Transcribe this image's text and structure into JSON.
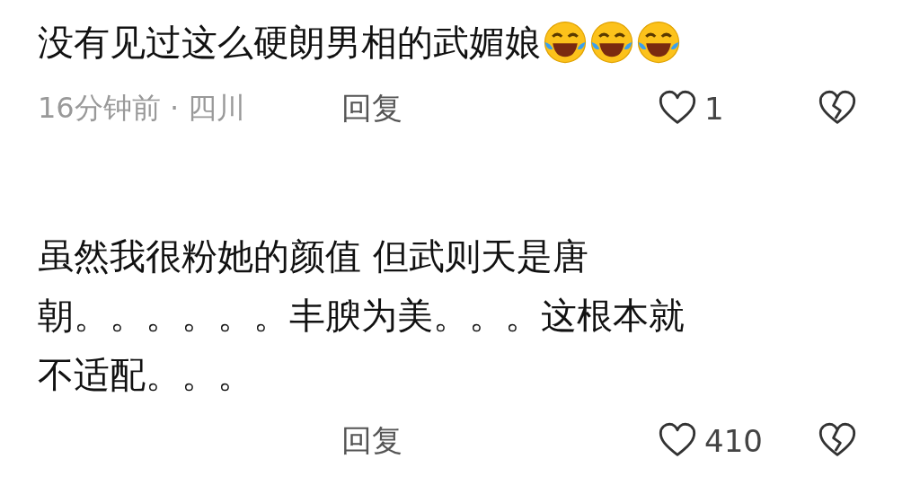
{
  "comments": [
    {
      "text_lines": [
        "没有见过这么硬朗男相的武媚娘"
      ],
      "emojis": [
        {
          "kind": "laugh-cry"
        },
        {
          "kind": "laugh-cry"
        },
        {
          "kind": "laugh-cry"
        }
      ],
      "meta": "16分钟前 · 四川",
      "reply": "回复",
      "likes": "1"
    },
    {
      "text_lines": [
        "虽然我很粉她的颜值 但武则天是唐",
        "朝。。。。。。丰腴为美。。。这根本就",
        "不适配。。。"
      ],
      "reply": "回复",
      "likes": "410"
    }
  ]
}
